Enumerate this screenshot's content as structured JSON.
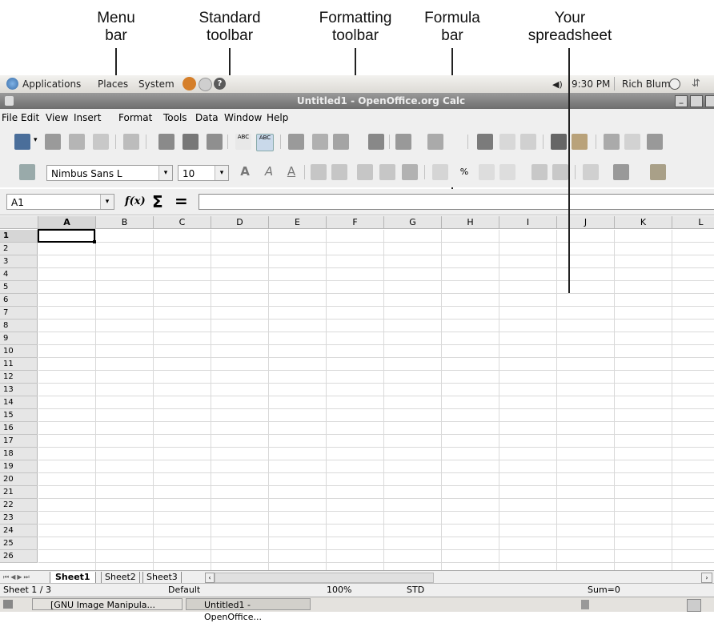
{
  "callouts": {
    "menu_bar": [
      "Menu",
      "bar"
    ],
    "standard_toolbar": [
      "Standard",
      "toolbar"
    ],
    "formatting_toolbar": [
      "Formatting",
      "toolbar"
    ],
    "formula_bar": [
      "Formula",
      "bar"
    ],
    "spreadsheet": [
      "Your",
      "spreadsheet"
    ]
  },
  "panel": {
    "menus": [
      "Applications",
      "Places",
      "System"
    ],
    "time": "9:30 PM",
    "user": "Rich Blum"
  },
  "window": {
    "title": "Untitled1 - OpenOffice.org Calc"
  },
  "menubar": [
    "File",
    "Edit",
    "View",
    "Insert",
    "Format",
    "Tools",
    "Data",
    "Window",
    "Help"
  ],
  "formatting": {
    "font": "Nimbus Sans L",
    "size": "10"
  },
  "formula": {
    "cell_ref": "A1",
    "fx_label": "f(x)",
    "sum_symbol": "Σ",
    "equals_symbol": "=",
    "value": ""
  },
  "sheet": {
    "columns": [
      "A",
      "B",
      "C",
      "D",
      "E",
      "F",
      "G",
      "H",
      "I",
      "J",
      "K",
      "L"
    ],
    "rows": [
      "1",
      "2",
      "3",
      "4",
      "5",
      "6",
      "7",
      "8",
      "9",
      "10",
      "11",
      "12",
      "13",
      "14",
      "15",
      "16",
      "17",
      "18",
      "19",
      "20",
      "21",
      "22",
      "23",
      "24",
      "25",
      "26"
    ],
    "active_cell": "A1"
  },
  "tabs": [
    "Sheet1",
    "Sheet2",
    "Sheet3"
  ],
  "statusbar": {
    "sheet": "Sheet 1 / 3",
    "style": "Default",
    "zoom": "100%",
    "mode": "STD",
    "sum": "Sum=0"
  },
  "taskbar": [
    "[GNU Image Manipula...",
    "Untitled1 - OpenOffice..."
  ]
}
